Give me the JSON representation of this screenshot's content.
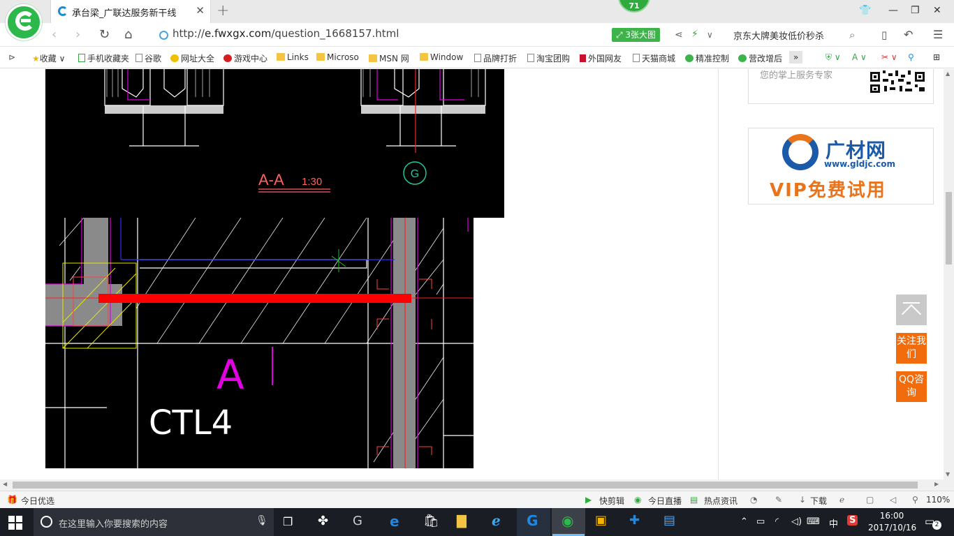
{
  "browser": {
    "tab_title": "承台梁_广联达服务新干线",
    "badge_count": "71",
    "url_prefix": "http://",
    "url_host": "e.fwxgx.com",
    "url_path": "/question_1668157.html",
    "big_image_label": "3张大图",
    "search_placeholder": "京东大牌美妆低价秒杀"
  },
  "bookmarks": [
    {
      "label": "收藏",
      "icon": "star-icon"
    },
    {
      "label": "手机收藏夹",
      "icon": "phone-icon"
    },
    {
      "label": "谷歌",
      "icon": "page-icon"
    },
    {
      "label": "网址大全",
      "icon": "site-icon"
    },
    {
      "label": "游戏中心",
      "icon": "game-icon"
    },
    {
      "label": "Links",
      "icon": "folder-icon"
    },
    {
      "label": "Microso",
      "icon": "folder-icon"
    },
    {
      "label": "MSN 网",
      "icon": "folder-icon"
    },
    {
      "label": "Window",
      "icon": "folder-icon"
    },
    {
      "label": "品牌打折",
      "icon": "page-icon"
    },
    {
      "label": "淘宝团购",
      "icon": "page-icon"
    },
    {
      "label": "外国网友",
      "icon": "bookmark-icon"
    },
    {
      "label": "天猫商城",
      "icon": "page-icon"
    },
    {
      "label": "精准控制",
      "icon": "wechat-icon"
    },
    {
      "label": "营改增后",
      "icon": "wechat-icon"
    }
  ],
  "cad": {
    "section_label": "A-A",
    "section_scale": "1:30",
    "axis_label": "G",
    "zone_label": "A",
    "beam_label": "CTL4"
  },
  "sidebar": {
    "service_text": "您的掌上服务专家",
    "ad_brand": "广材网",
    "ad_url": "www.gldjc.com",
    "ad_slogan": "VIP免费试用",
    "follow_label": "关注我们",
    "qq_label": "QQ咨询"
  },
  "statusbar": {
    "left_label": "今日优选",
    "items": [
      "快剪辑",
      "今日直播",
      "热点资讯",
      "下载"
    ],
    "zoom": "110%"
  },
  "taskbar": {
    "search_placeholder": "在这里输入你要搜索的内容",
    "ime": "中",
    "time": "16:00",
    "date": "2017/10/16",
    "notifications": "2"
  },
  "colors": {
    "brand_green": "#2db84b",
    "accent_orange": "#f26c0d",
    "cad_red_bar": "#ff0000",
    "cad_magenta": "#e000e0"
  }
}
